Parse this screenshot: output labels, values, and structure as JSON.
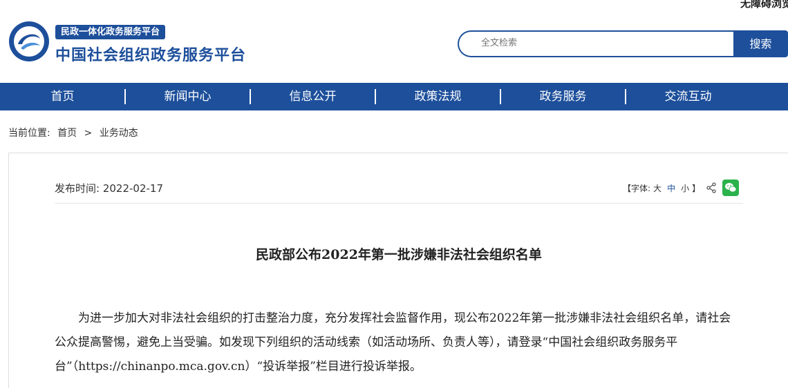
{
  "accessibility": {
    "label": "无障碍浏览"
  },
  "brand": {
    "tag": "民政一体化政务服务平台",
    "title": "中国社会组织政务服务平台"
  },
  "search": {
    "placeholder": "全文检索",
    "button": "搜索"
  },
  "nav": {
    "items": [
      "首页",
      "新闻中心",
      "信息公开",
      "政策法规",
      "政务服务",
      "交流互动"
    ]
  },
  "breadcrumb": {
    "label": "当前位置:",
    "home": "首页",
    "sep": ">",
    "current": "业务动态"
  },
  "article": {
    "publish_label": "发布时间:",
    "publish_date": "2022-02-17",
    "font_label": "【字体:",
    "font_large": "大",
    "font_medium": "中",
    "font_small": "小",
    "font_end": "】",
    "title": "民政部公布2022年第一批涉嫌非法社会组织名单",
    "body": "为进一步加大对非法社会组织的打击整治力度，充分发挥社会监督作用，现公布2022年第一批涉嫌非法社会组织名单，请社会公众提高警惕，避免上当受骗。如发现下列组织的活动线索（如活动场所、负责人等），请登录“中国社会组织政务服务平台”（https://chinanpo.mca.gov.cn）“投诉举报”栏目进行投诉举报。"
  },
  "colors": {
    "primary": "#1d4f9b",
    "wechat": "#2bb24c"
  }
}
